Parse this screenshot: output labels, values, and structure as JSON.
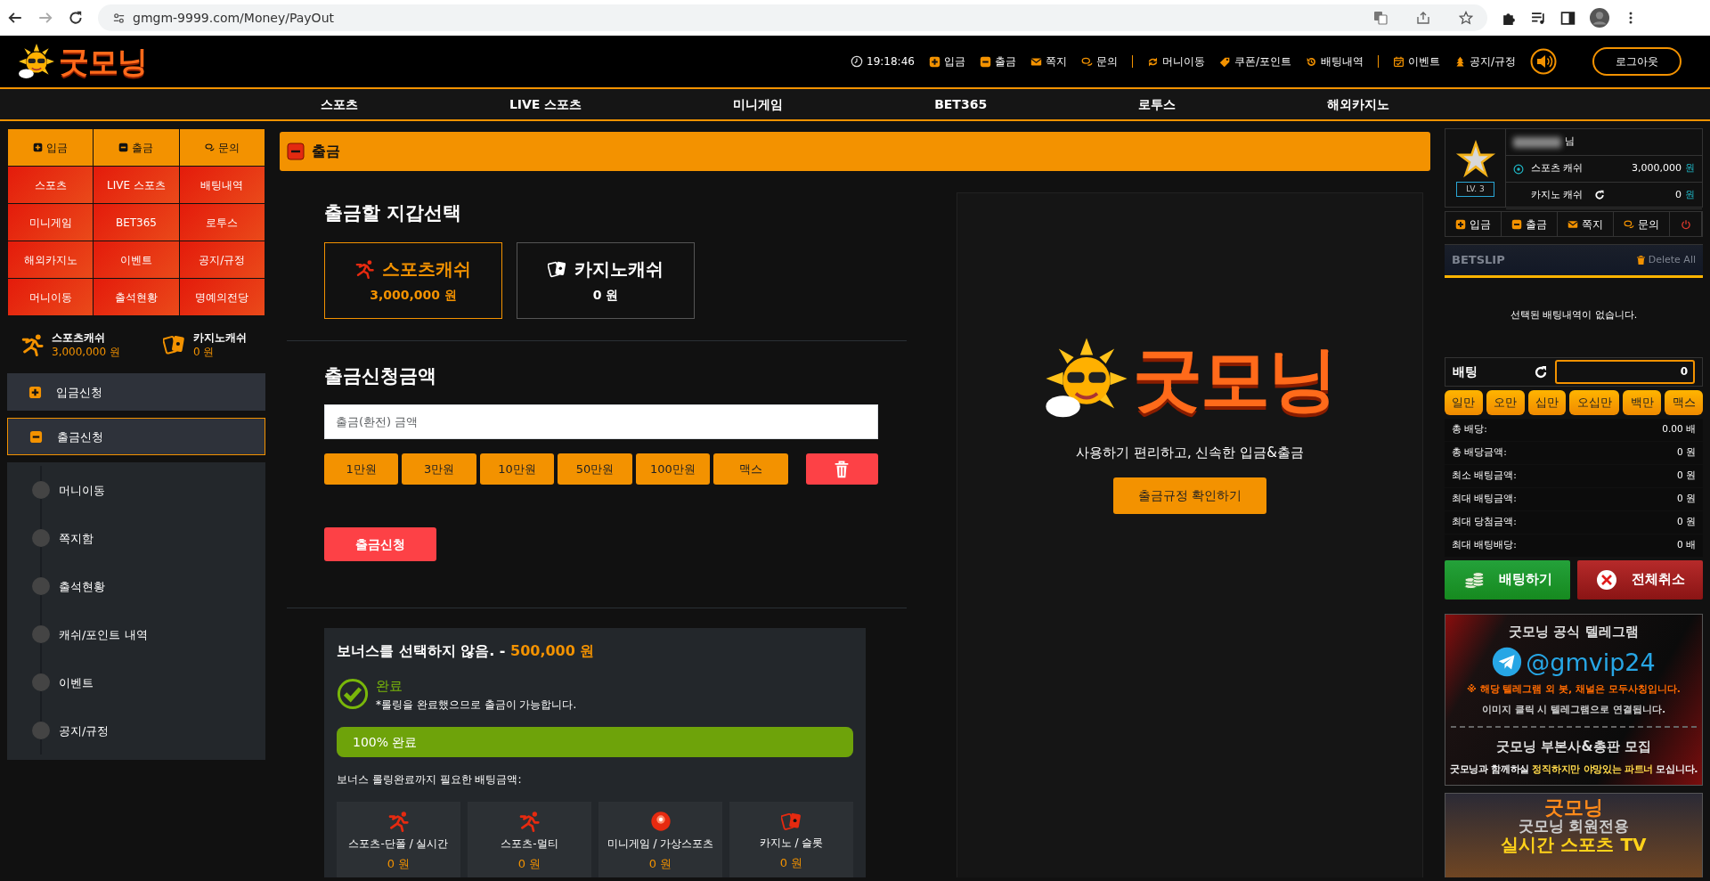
{
  "browser": {
    "url": "gmgm-9999.com/Money/PayOut"
  },
  "header": {
    "logo": "굿모닝",
    "time": "19:18:46",
    "link_groups": [
      [
        {
          "label": "입금",
          "kind": "plus"
        },
        {
          "label": "출금",
          "kind": "minus"
        },
        {
          "label": "쪽지",
          "kind": "mail"
        },
        {
          "label": "문의",
          "kind": "chat"
        }
      ],
      [
        {
          "label": "머니이동",
          "kind": "exchange"
        },
        {
          "label": "쿠폰/포인트",
          "kind": "tag"
        },
        {
          "label": "배팅내역",
          "kind": "history"
        }
      ],
      [
        {
          "label": "이벤트",
          "kind": "calendar"
        },
        {
          "label": "공지/규정",
          "kind": "tree"
        }
      ]
    ],
    "logout": "로그아웃"
  },
  "nav": [
    "스포츠",
    "LIVE 스포츠",
    "미니게임",
    "BET365",
    "로투스",
    "해외카지노"
  ],
  "sidebar": {
    "quick": [
      {
        "label": "입금",
        "kind": "plus"
      },
      {
        "label": "출금",
        "kind": "minus"
      },
      {
        "label": "문의",
        "kind": "chat"
      }
    ],
    "grid": [
      "스포츠",
      "LIVE 스포츠",
      "배팅내역",
      "미니게임",
      "BET365",
      "로투스",
      "해외카지노",
      "이벤트",
      "공지/규정",
      "머니이동",
      "출석현황",
      "명예의전당"
    ],
    "wallets": [
      {
        "label": "스포츠캐쉬",
        "amount": "3,000,000 원",
        "kind": "sports"
      },
      {
        "label": "카지노캐쉬",
        "amount": "0 원",
        "kind": "casino"
      }
    ],
    "menu": [
      {
        "label": "입금신청",
        "expanded": false
      },
      {
        "label": "출금신청",
        "expanded": true,
        "children": [
          {
            "label": "머니이동"
          },
          {
            "label": "쪽지함"
          },
          {
            "label": "출석현황"
          },
          {
            "label": "캐쉬/포인트 내역"
          },
          {
            "label": "이벤트"
          },
          {
            "label": "공지/규정"
          }
        ]
      }
    ]
  },
  "main": {
    "title": "출금",
    "wallet_section": {
      "title": "출금할 지갑선택",
      "wallets": [
        {
          "name": "스포츠캐쉬",
          "amount": "3,000,000 원",
          "kind": "sports",
          "selected": true
        },
        {
          "name": "카지노캐쉬",
          "amount": "0 원",
          "kind": "casino",
          "selected": false
        }
      ]
    },
    "amount_section": {
      "title": "출금신청금액",
      "placeholder": "출금(환전) 금액",
      "quick_amounts": [
        "1만원",
        "3만원",
        "10만원",
        "50만원",
        "100만원",
        "맥스"
      ],
      "submit": "출금신청"
    },
    "bonus": {
      "title": "보너스를 선택하지 않음. - **500,000 원**",
      "status": "완료",
      "note": "*롤링을 완료했으므로 출금이 가능합니다.",
      "progress": {
        "level": 1,
        "label": "100% 완료"
      },
      "required_label": "보너스 롤링완료까지 필요한 배팅금액:",
      "categories": [
        {
          "name": "스포츠-단폴 / 실시간",
          "amount": "0 원",
          "kind": "sports"
        },
        {
          "name": "스포츠-멀티",
          "amount": "0 원",
          "kind": "sports"
        },
        {
          "name": "미니게임 / 가상스포츠",
          "amount": "0 원",
          "kind": "ball"
        },
        {
          "name": "카지노 / 슬롯",
          "amount": "0 원",
          "kind": "casino"
        }
      ]
    },
    "promo": {
      "logo": "굿모닝",
      "tagline": "사용하기 편리하고, 신속한 입금&출금",
      "button": "출금규정 확인하기"
    }
  },
  "right": {
    "profile": {
      "level": "LV. 3",
      "suffix": "님",
      "rows": [
        {
          "label": "스포츠 캐쉬",
          "value": "3,000,000",
          "unit": "원",
          "kind": "sports"
        },
        {
          "label": "카지노 캐쉬",
          "value": "0",
          "unit": "원",
          "kind": "casino"
        }
      ]
    },
    "actions": [
      {
        "label": "입금",
        "kind": "plus"
      },
      {
        "label": "출금",
        "kind": "minus"
      },
      {
        "label": "쪽지",
        "kind": "mail"
      },
      {
        "label": "문의",
        "kind": "chat"
      },
      {
        "kind": "power"
      }
    ],
    "betslip": {
      "title": "BETSLIP",
      "delete": "Delete All",
      "empty": "선택된 배팅내역이 없습니다.",
      "bet_label": "배팅",
      "bet_value": "0",
      "chips": [
        "일만",
        "오만",
        "십만",
        "오십만",
        "백만",
        "맥스"
      ],
      "stats": [
        {
          "label": "총 배당:",
          "value": "0.00 배"
        },
        {
          "label": "총 배당금액:",
          "value": "0 원"
        },
        {
          "label": "최소 배팅금액:",
          "value": "0 원"
        },
        {
          "label": "최대 배팅금액:",
          "value": "0 원"
        },
        {
          "label": "최대 당첨금액:",
          "value": "0 원"
        },
        {
          "label": "최대 배팅배당:",
          "value": "0 배"
        }
      ],
      "place": "배팅하기",
      "cancel": "전체취소"
    },
    "banners": [
      {
        "kind": "telegram",
        "title": "굿모닝 공식 텔레그램",
        "handle": "@gmvip24",
        "warning": "※ 해당 텔레그램 외 봇, 채널은 모두사칭입니다.",
        "note": "이미지 클릭 시 텔레그램으로 연결됩니다.",
        "recruit": "굿모닝 부본사&총판 모집",
        "recruit_note": "굿모닝과 함께하실 **정직하지만 야망있는 파트너** 모십니다."
      },
      {
        "kind": "tv",
        "logo": "굿모닝",
        "line": "굿모닝 회원전용",
        "title": "실시간 스포츠 TV"
      }
    ]
  }
}
